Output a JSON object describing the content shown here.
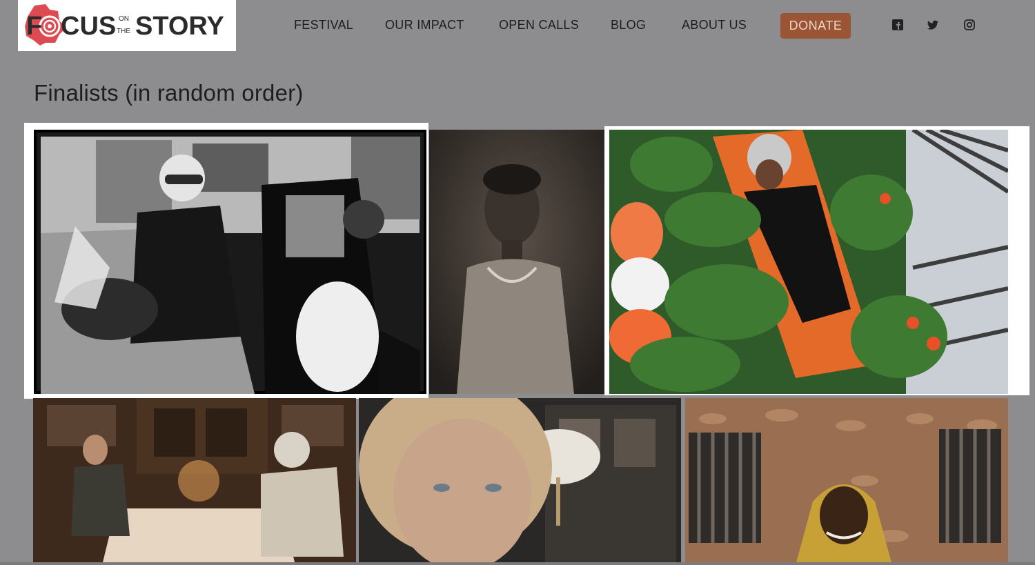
{
  "brand": {
    "logo_part1": "F",
    "logo_part2": "CUS",
    "logo_on": "ON",
    "logo_the": "THE",
    "logo_part3": "STORY",
    "accent": "#d9363e"
  },
  "nav": {
    "items": [
      {
        "label": "FESTIVAL"
      },
      {
        "label": "OUR IMPACT"
      },
      {
        "label": "OPEN CALLS"
      },
      {
        "label": "BLOG"
      },
      {
        "label": "ABOUT US"
      }
    ],
    "donate_label": "DONATE",
    "donate_color": "#9a5536",
    "social": [
      "facebook-icon",
      "twitter-icon",
      "instagram-icon"
    ]
  },
  "page": {
    "title": "Finalists (in random order)"
  },
  "gallery": {
    "photos": [
      {
        "subject": "motorcyclist-wedding-bw"
      },
      {
        "subject": "child-portrait-bw"
      },
      {
        "subject": "woman-on-orange-lounger-plants"
      },
      {
        "subject": "elderly-couple-dinner-table"
      },
      {
        "subject": "elderly-woman-portrait"
      },
      {
        "subject": "girl-headscarf-before-wall"
      }
    ]
  }
}
